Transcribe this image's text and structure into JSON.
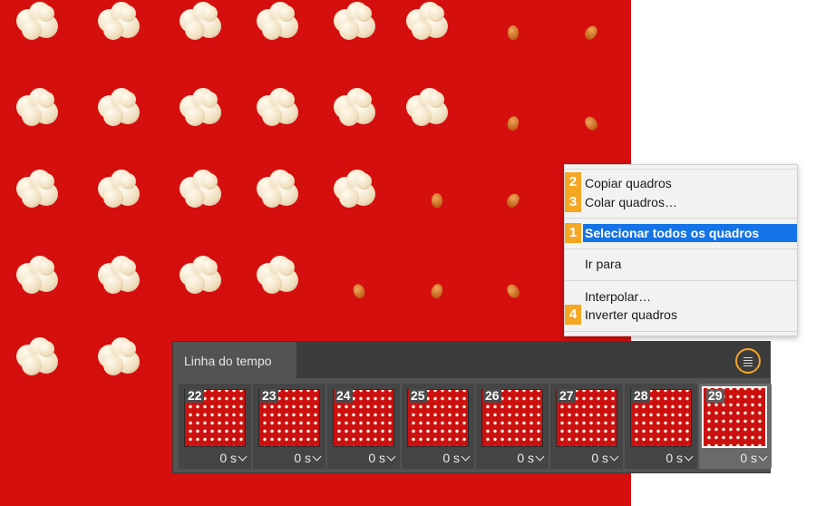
{
  "context_menu": {
    "items": [
      {
        "label": "Copiar quadros",
        "badge": "2"
      },
      {
        "label": "Colar quadros…",
        "badge": "3"
      },
      {
        "label": "Selecionar todos os quadros",
        "badge": "1",
        "selected": true
      },
      {
        "label": "Ir para"
      },
      {
        "label": "Interpolar…"
      },
      {
        "label": "Inverter quadros",
        "badge": "4"
      }
    ]
  },
  "timeline": {
    "tab_label": "Linha do tempo",
    "menu_icon": "panel-menu-icon",
    "frames": [
      {
        "number": "22",
        "delay": "0 s"
      },
      {
        "number": "23",
        "delay": "0 s"
      },
      {
        "number": "24",
        "delay": "0 s"
      },
      {
        "number": "25",
        "delay": "0 s"
      },
      {
        "number": "26",
        "delay": "0 s"
      },
      {
        "number": "27",
        "delay": "0 s"
      },
      {
        "number": "28",
        "delay": "0 s"
      },
      {
        "number": "29",
        "delay": "0 s",
        "active": true
      }
    ]
  },
  "colors": {
    "background_red": "#d50e0e",
    "highlight": "#1473e6",
    "badge_orange": "#f5a623",
    "panel_gray": "#535353"
  }
}
